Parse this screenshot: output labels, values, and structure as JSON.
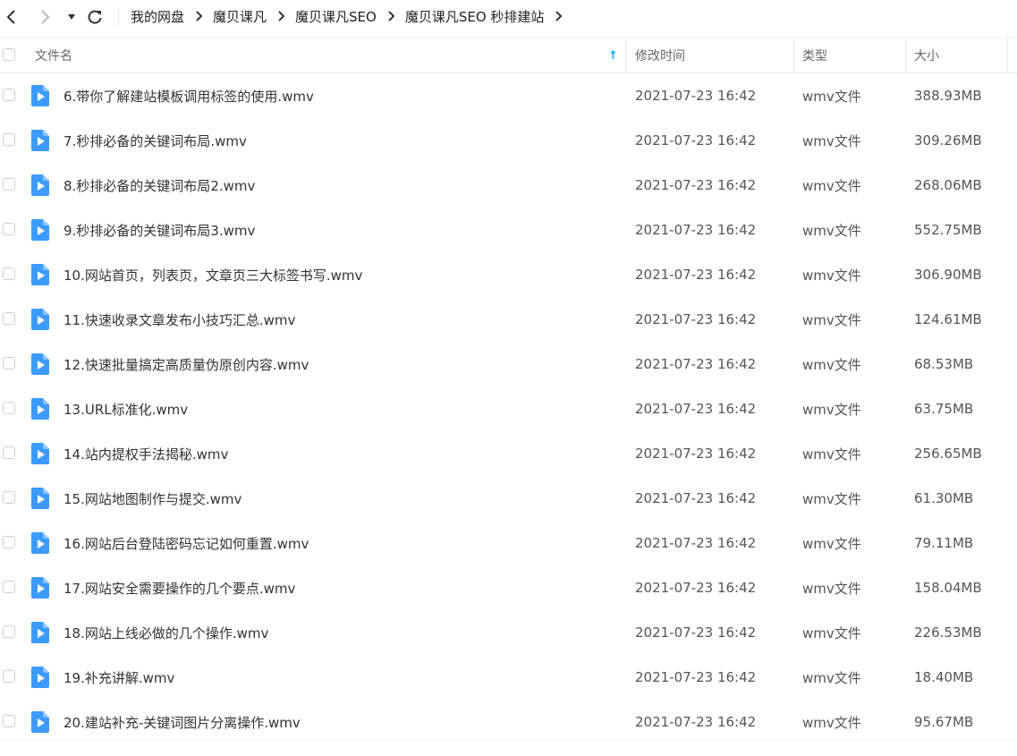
{
  "breadcrumb": [
    "我的网盘",
    "魔贝课凡",
    "魔贝课凡SEO",
    "魔贝课凡SEO 秒排建站"
  ],
  "columns": {
    "name": "文件名",
    "modified": "修改时间",
    "type": "类型",
    "size": "大小"
  },
  "sort_indicator": "↑",
  "colors": {
    "accent": "#06a7ff",
    "icon_blue": "#3d9bff"
  },
  "files": [
    {
      "name": "6.带你了解建站模板调用标签的使用.wmv",
      "modified": "2021-07-23 16:42",
      "type": "wmv文件",
      "size": "388.93MB"
    },
    {
      "name": "7.秒排必备的关键词布局.wmv",
      "modified": "2021-07-23 16:42",
      "type": "wmv文件",
      "size": "309.26MB"
    },
    {
      "name": "8.秒排必备的关键词布局2.wmv",
      "modified": "2021-07-23 16:42",
      "type": "wmv文件",
      "size": "268.06MB"
    },
    {
      "name": "9.秒排必备的关键词布局3.wmv",
      "modified": "2021-07-23 16:42",
      "type": "wmv文件",
      "size": "552.75MB"
    },
    {
      "name": "10.网站首页，列表页，文章页三大标签书写.wmv",
      "modified": "2021-07-23 16:42",
      "type": "wmv文件",
      "size": "306.90MB"
    },
    {
      "name": "11.快速收录文章发布小技巧汇总.wmv",
      "modified": "2021-07-23 16:42",
      "type": "wmv文件",
      "size": "124.61MB"
    },
    {
      "name": "12.快速批量搞定高质量伪原创内容.wmv",
      "modified": "2021-07-23 16:42",
      "type": "wmv文件",
      "size": "68.53MB"
    },
    {
      "name": "13.URL标准化.wmv",
      "modified": "2021-07-23 16:42",
      "type": "wmv文件",
      "size": "63.75MB"
    },
    {
      "name": "14.站内提权手法揭秘.wmv",
      "modified": "2021-07-23 16:42",
      "type": "wmv文件",
      "size": "256.65MB"
    },
    {
      "name": "15.网站地图制作与提交.wmv",
      "modified": "2021-07-23 16:42",
      "type": "wmv文件",
      "size": "61.30MB"
    },
    {
      "name": "16.网站后台登陆密码忘记如何重置.wmv",
      "modified": "2021-07-23 16:42",
      "type": "wmv文件",
      "size": "79.11MB"
    },
    {
      "name": "17.网站安全需要操作的几个要点.wmv",
      "modified": "2021-07-23 16:42",
      "type": "wmv文件",
      "size": "158.04MB"
    },
    {
      "name": "18.网站上线必做的几个操作.wmv",
      "modified": "2021-07-23 16:42",
      "type": "wmv文件",
      "size": "226.53MB"
    },
    {
      "name": "19.补充讲解.wmv",
      "modified": "2021-07-23 16:42",
      "type": "wmv文件",
      "size": "18.40MB"
    },
    {
      "name": "20.建站补充-关键词图片分离操作.wmv",
      "modified": "2021-07-23 16:42",
      "type": "wmv文件",
      "size": "95.67MB"
    }
  ]
}
